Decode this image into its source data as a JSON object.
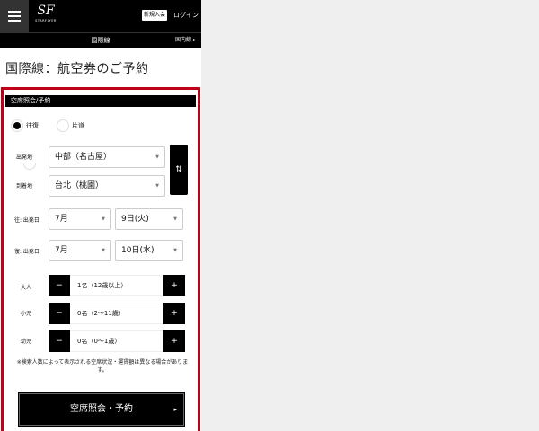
{
  "header": {
    "logo_mark": "SF",
    "logo_text": "STARFLYER",
    "signup_label": "新規入会",
    "login_label": "ログイン",
    "section_title": "国際線",
    "domestic_link": "国内線",
    "domestic_arrow": "▸"
  },
  "page": {
    "title": "国際線：航空券のご予約"
  },
  "form": {
    "heading": "空席照会/予約",
    "trip_types": [
      {
        "label": "往復",
        "selected": true
      },
      {
        "label": "片道",
        "selected": false
      }
    ],
    "departure_label": "出発地",
    "departure_value": "中部（名古屋）",
    "arrival_label": "到着地",
    "arrival_value": "台北（桃園）",
    "swap_icon": "⇅",
    "outbound_label": "往: 出発日",
    "outbound_month": "7月",
    "outbound_day": "9日(火)",
    "return_label": "復: 出発日",
    "return_month": "7月",
    "return_day": "10日(水)",
    "caret": "▼",
    "passengers": [
      {
        "label": "大人",
        "value": "1名（12歳以上）"
      },
      {
        "label": "小児",
        "value": "0名（2〜11歳）"
      },
      {
        "label": "幼児",
        "value": "0名（0〜1歳）"
      }
    ],
    "minus": "−",
    "plus": "+",
    "note": "※検索人数によって表示される空席状況・運賃額は異なる場合があります。",
    "submit_label": "空席照会・予約",
    "submit_arrow": "▸"
  }
}
